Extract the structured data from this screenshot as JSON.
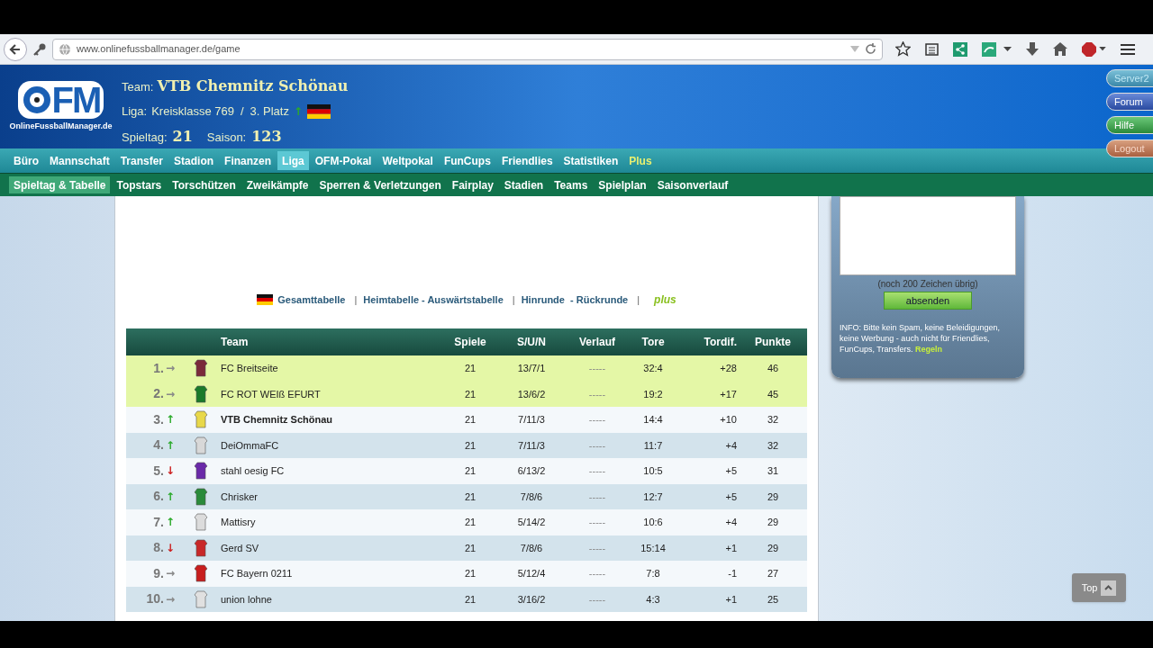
{
  "browser": {
    "url": "www.onlinefussballmanager.de/game"
  },
  "logo": {
    "mark": "FM",
    "site": "OnlineFussballManager.de"
  },
  "header": {
    "team_label": "Team:",
    "team_name": "VTB Chemnitz Schönau",
    "liga_label": "Liga:",
    "liga": "Kreisklasse 769",
    "separator": "/",
    "place": "3. Platz",
    "trend": {
      "symbol": "↑",
      "color": "#2aaa2a"
    },
    "spieltag_label": "Spieltag:",
    "spieltag": "21",
    "saison_label": "Saison:",
    "saison": "123"
  },
  "side_buttons": [
    {
      "label": "Server2",
      "kind": "server"
    },
    {
      "label": "Forum",
      "kind": "forum"
    },
    {
      "label": "Hilfe",
      "kind": "help"
    },
    {
      "label": "Logout",
      "kind": "logout"
    }
  ],
  "nav_main": [
    {
      "label": "Büro",
      "selected": false,
      "kind": "normal"
    },
    {
      "label": "Mannschaft",
      "selected": false,
      "kind": "normal"
    },
    {
      "label": "Transfer",
      "selected": false,
      "kind": "normal"
    },
    {
      "label": "Stadion",
      "selected": false,
      "kind": "normal"
    },
    {
      "label": "Finanzen",
      "selected": false,
      "kind": "normal"
    },
    {
      "label": "Liga",
      "selected": true,
      "kind": "normal"
    },
    {
      "label": "OFM-Pokal",
      "selected": false,
      "kind": "normal"
    },
    {
      "label": "Weltpokal",
      "selected": false,
      "kind": "normal"
    },
    {
      "label": "FunCups",
      "selected": false,
      "kind": "normal"
    },
    {
      "label": "Friendlies",
      "selected": false,
      "kind": "normal"
    },
    {
      "label": "Statistiken",
      "selected": false,
      "kind": "normal"
    },
    {
      "label": "Plus",
      "selected": false,
      "kind": "plus"
    }
  ],
  "nav_sub": [
    {
      "label": "Spieltag & Tabelle",
      "selected": true
    },
    {
      "label": "Topstars",
      "selected": false
    },
    {
      "label": "Torschützen",
      "selected": false
    },
    {
      "label": "Zweikämpfe",
      "selected": false
    },
    {
      "label": "Sperren & Verletzungen",
      "selected": false
    },
    {
      "label": "Fairplay",
      "selected": false
    },
    {
      "label": "Stadien",
      "selected": false
    },
    {
      "label": "Teams",
      "selected": false
    },
    {
      "label": "Spielplan",
      "selected": false
    },
    {
      "label": "Saisonverlauf",
      "selected": false
    }
  ],
  "filters": {
    "links": [
      "Gesamttabelle",
      "Heimtabelle - Auswärtstabelle",
      "Hinrunde  - Rückrunde"
    ],
    "separator": "|",
    "plus": "plus"
  },
  "table": {
    "columns": [
      "Team",
      "Spiele",
      "S/U/N",
      "Verlauf",
      "Tore",
      "Tordif.",
      "Punkte"
    ],
    "rows": [
      {
        "rank": "1.",
        "trend": {
          "symbol": "→",
          "color": "#888888"
        },
        "color": "#7a2a3a",
        "team": "FC Breitseite",
        "games": "21",
        "record": "13/7/1",
        "form": "-----",
        "goals": "32:4",
        "diff": "+28",
        "points": "46",
        "promotion": true,
        "own_team": false
      },
      {
        "rank": "2.",
        "trend": {
          "symbol": "→",
          "color": "#888888"
        },
        "color": "#1a7a2a",
        "team": "FC ROT WEIß EFURT",
        "games": "21",
        "record": "13/6/2",
        "form": "-----",
        "goals": "19:2",
        "diff": "+17",
        "points": "45",
        "promotion": true,
        "own_team": false
      },
      {
        "rank": "3.",
        "trend": {
          "symbol": "↑",
          "color": "#2aaa2a"
        },
        "color": "#e8d84a",
        "team": "VTB Chemnitz Schönau",
        "games": "21",
        "record": "7/11/3",
        "form": "-----",
        "goals": "14:4",
        "diff": "+10",
        "points": "32",
        "promotion": false,
        "own_team": true
      },
      {
        "rank": "4.",
        "trend": {
          "symbol": "↑",
          "color": "#2aaa2a"
        },
        "color": "#d8d8d8",
        "team": "DeiOmmaFC",
        "games": "21",
        "record": "7/11/3",
        "form": "-----",
        "goals": "11:7",
        "diff": "+4",
        "points": "32",
        "promotion": false,
        "own_team": false
      },
      {
        "rank": "5.",
        "trend": {
          "symbol": "↓",
          "color": "#cc2020"
        },
        "color": "#6a2aa8",
        "team": "stahl oesig FC",
        "games": "21",
        "record": "6/13/2",
        "form": "-----",
        "goals": "10:5",
        "diff": "+5",
        "points": "31",
        "promotion": false,
        "own_team": false
      },
      {
        "rank": "6.",
        "trend": {
          "symbol": "↑",
          "color": "#2aaa2a"
        },
        "color": "#2a8a3a",
        "team": "Chrisker",
        "games": "21",
        "record": "7/8/6",
        "form": "-----",
        "goals": "12:7",
        "diff": "+5",
        "points": "29",
        "promotion": false,
        "own_team": false
      },
      {
        "rank": "7.",
        "trend": {
          "symbol": "↑",
          "color": "#2aaa2a"
        },
        "color": "#dcdcdc",
        "team": "Mattisry",
        "games": "21",
        "record": "5/14/2",
        "form": "-----",
        "goals": "10:6",
        "diff": "+4",
        "points": "29",
        "promotion": false,
        "own_team": false
      },
      {
        "rank": "8.",
        "trend": {
          "symbol": "↓",
          "color": "#cc2020"
        },
        "color": "#c82828",
        "team": "Gerd SV",
        "games": "21",
        "record": "7/8/6",
        "form": "-----",
        "goals": "15:14",
        "diff": "+1",
        "points": "29",
        "promotion": false,
        "own_team": false
      },
      {
        "rank": "9.",
        "trend": {
          "symbol": "→",
          "color": "#888888"
        },
        "color": "#c81e1e",
        "team": "FC Bayern 0211",
        "games": "21",
        "record": "5/12/4",
        "form": "-----",
        "goals": "7:8",
        "diff": "-1",
        "points": "27",
        "promotion": false,
        "own_team": false
      },
      {
        "rank": "10.",
        "trend": {
          "symbol": "→",
          "color": "#888888"
        },
        "color": "#e0e0e0",
        "team": "union lohne",
        "games": "21",
        "record": "3/16/2",
        "form": "-----",
        "goals": "4:3",
        "diff": "+1",
        "points": "25",
        "promotion": false,
        "own_team": false
      }
    ]
  },
  "chat": {
    "counter": "(noch 200 Zeichen übrig)",
    "send_button": "absenden",
    "info": "INFO: Bitte kein Spam, keine Beleidigungen, keine Werbung - auch nicht für Friendlies, FunCups, Transfers.",
    "rules_link": "Regeln"
  },
  "top_button": "Top"
}
